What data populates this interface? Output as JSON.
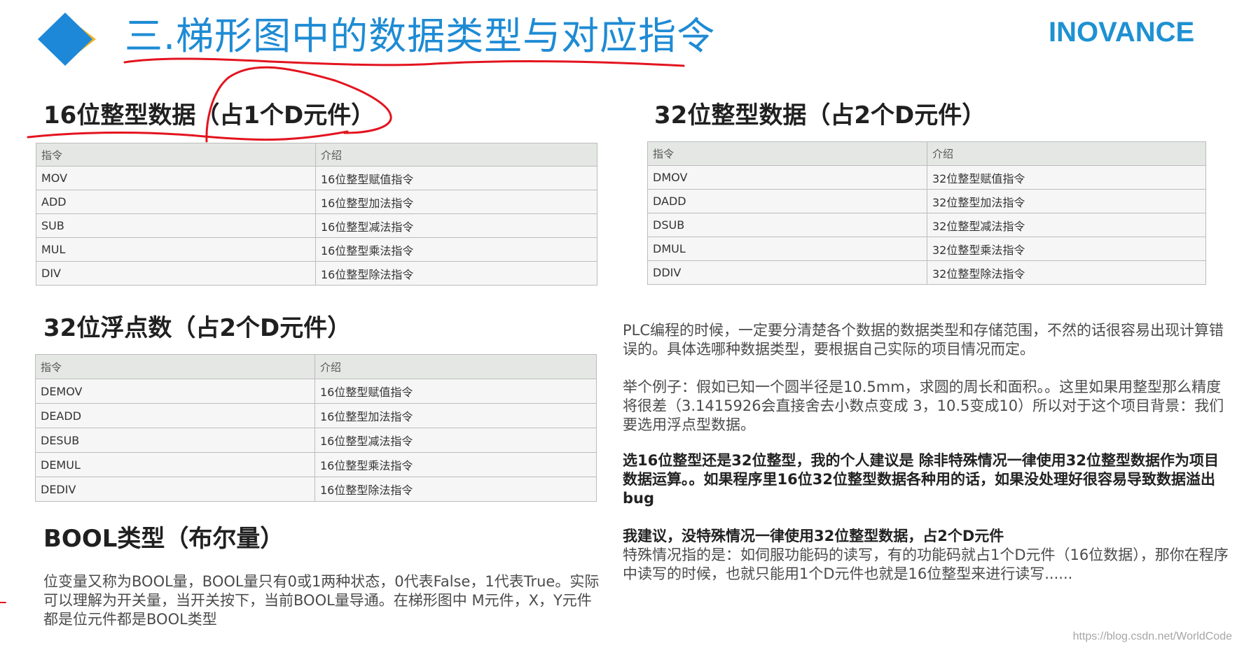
{
  "header": {
    "title": "三.梯形图中的数据类型与对应指令",
    "brand": "INOVANCE"
  },
  "sections": {
    "int16": {
      "title": "16位整型数据（占1个D元件）",
      "headers": [
        "指令",
        "介绍"
      ],
      "rows": [
        [
          "MOV",
          "16位整型赋值指令"
        ],
        [
          "ADD",
          "16位整型加法指令"
        ],
        [
          "SUB",
          "16位整型减法指令"
        ],
        [
          "MUL",
          "16位整型乘法指令"
        ],
        [
          "DIV",
          "16位整型除法指令"
        ]
      ]
    },
    "int32": {
      "title": "32位整型数据（占2个D元件）",
      "headers": [
        "指令",
        "介绍"
      ],
      "rows": [
        [
          "DMOV",
          "32位整型赋值指令"
        ],
        [
          "DADD",
          "32位整型加法指令"
        ],
        [
          "DSUB",
          "32位整型减法指令"
        ],
        [
          "DMUL",
          "32位整型乘法指令"
        ],
        [
          "DDIV",
          "32位整型除法指令"
        ]
      ]
    },
    "float32": {
      "title": "32位浮点数（占2个D元件）",
      "headers": [
        "指令",
        "介绍"
      ],
      "rows": [
        [
          "DEMOV",
          "16位整型赋值指令"
        ],
        [
          "DEADD",
          "16位整型加法指令"
        ],
        [
          "DESUB",
          "16位整型减法指令"
        ],
        [
          "DEMUL",
          "16位整型乘法指令"
        ],
        [
          "DEDIV",
          "16位整型除法指令"
        ]
      ]
    },
    "bool": {
      "title": "BOOL类型（布尔量）",
      "text": "位变量又称为BOOL量，BOOL量只有0或1两种状态，0代表False，1代表True。实际可以理解为开关量，当开关按下，当前BOOL量导通。在梯形图中 M元件，X，Y元件都是位元件都是BOOL类型"
    }
  },
  "notes": {
    "p1": "PLC编程的时候，一定要分清楚各个数据的数据类型和存储范围，不然的话很容易出现计算错误的。具体选哪种数据类型，要根据自己实际的项目情况而定。",
    "p2": "举个例子：假如已知一个圆半径是10.5mm，求圆的周长和面积。。这里如果用整型那么精度将很差（3.1415926会直接舍去小数点变成 3，10.5变成10）所以对于这个项目背景：我们要选用浮点型数据。",
    "p3": "选16位整型还是32位整型，我的个人建议是 除非特殊情况一律使用32位整型数据作为项目数据运算。。如果程序里16位32位整型数据各种用的话，如果没处理好很容易导致数据溢出bug",
    "p4": "我建议，没特殊情况一律使用32位整型数据，占2个D元件",
    "p5": "特殊情况指的是：如伺服功能码的读写，有的功能码就占1个D元件（16位数据），那你在程序中读写的时候，也就只能用1个D元件也就是16位整型来进行读写......"
  },
  "watermark": "https://blog.csdn.net/WorldCode",
  "colors": {
    "title_blue": "#1e8bd4",
    "logo_blue": "#1e88d8",
    "logo_yellow": "#f2b422",
    "annotation_red": "#e3141f"
  },
  "icons": {
    "logo_mark": "blue-yellow-diamond-icon"
  }
}
